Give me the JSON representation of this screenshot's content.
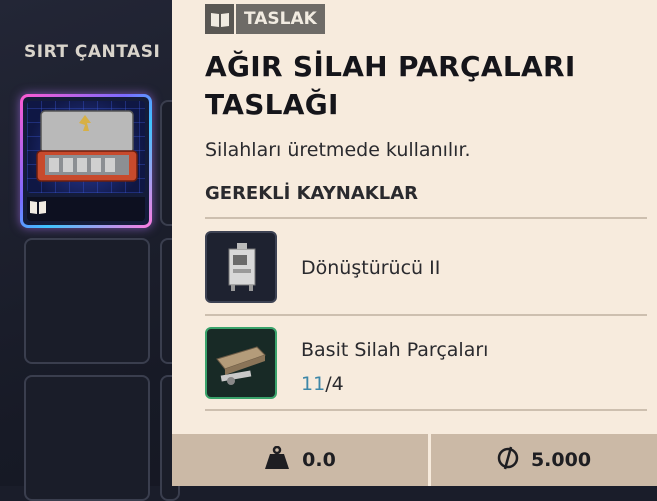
{
  "backpack": {
    "title": "SIRT ÇANTASI"
  },
  "item": {
    "tag_label": "TASLAK",
    "title_line1": "AĞIR SİLAH PARÇALARI",
    "title_line2": "TASLAĞI",
    "description": "Silahları üretmede kullanılır.",
    "requirements_heading": "GEREKLİ KAYNAKLAR",
    "requirements": [
      {
        "name": "Dönüştürücü II",
        "rarity": "common",
        "icon": "converter-machine-icon"
      },
      {
        "name": "Basit Silah Parçaları",
        "have": "11",
        "sep": "/",
        "need": "4",
        "rarity": "uncommon",
        "icon": "weapon-parts-icon"
      }
    ],
    "weight": "0.0",
    "price": "5.000"
  },
  "colors": {
    "panel_bg": "#f7ebdd",
    "have_count": "#3d87a8",
    "uncommon_border": "#3aa36b",
    "footer_bg": "#cbb9a6"
  }
}
